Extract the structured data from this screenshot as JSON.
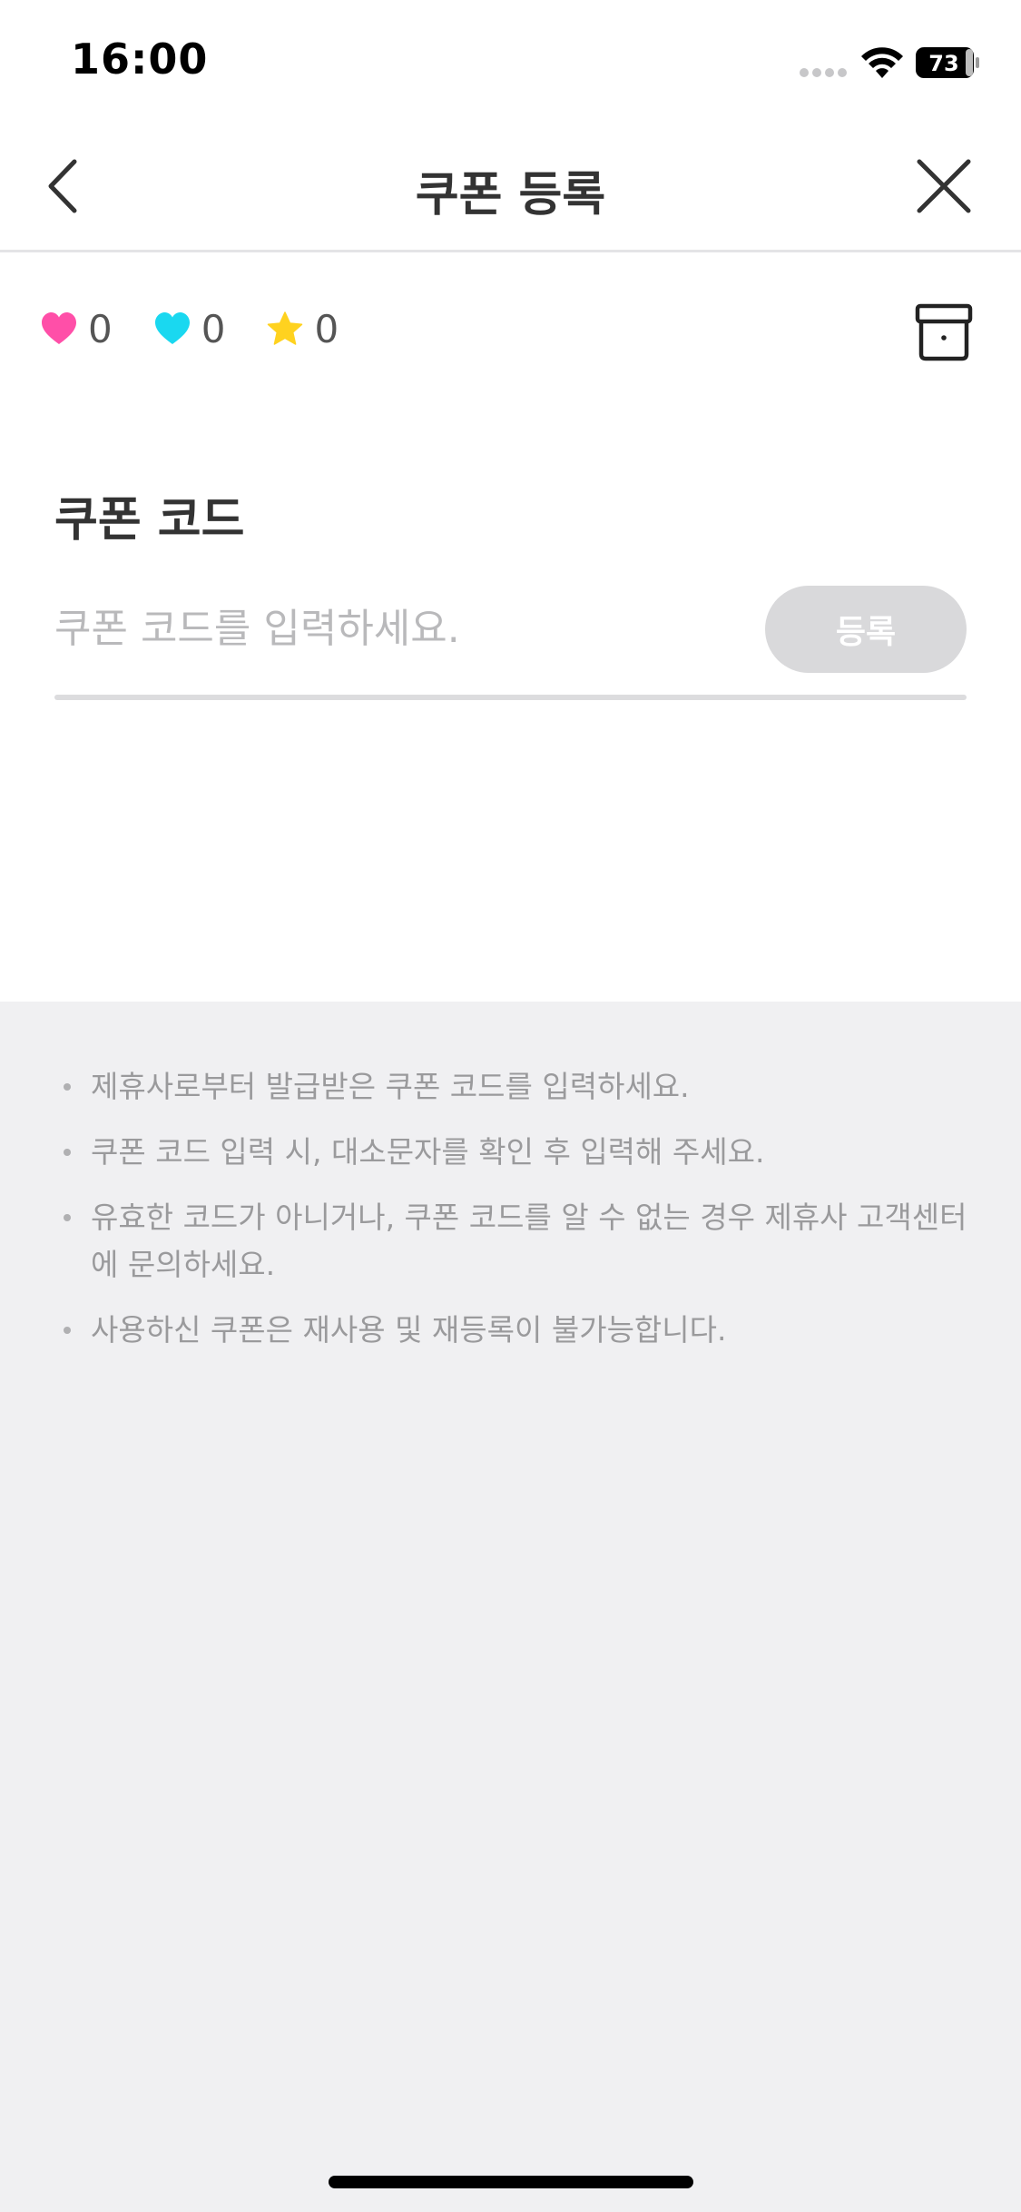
{
  "status_bar": {
    "time": "16:00",
    "battery_level": "73"
  },
  "nav": {
    "title": "쿠폰 등록",
    "back_icon": "chevron-left-icon",
    "close_icon": "close-icon"
  },
  "points": [
    {
      "icon": "pink-heart-icon",
      "color": "#ff4fa8",
      "value": "0"
    },
    {
      "icon": "cyan-heart-icon",
      "color": "#1ad8f0",
      "value": "0"
    },
    {
      "icon": "star-icon",
      "color": "#ffd21f",
      "value": "0"
    }
  ],
  "storage_icon": "box-icon",
  "coupon": {
    "section_title": "쿠폰 코드",
    "input_placeholder": "쿠폰 코드를 입력하세요.",
    "input_value": "",
    "register_label": "등록",
    "register_button_color": "#d9d9db"
  },
  "notices": [
    "제휴사로부터 발급받은 쿠폰 코드를 입력하세요.",
    "쿠폰 코드 입력 시, 대소문자를 확인 후 입력해 주세요.",
    "유효한 코드가 아니거나, 쿠폰 코드를 알 수 없는 경우 제휴사 고객센터에 문의하세요.",
    "사용하신 쿠폰은 재사용 및 재등록이 불가능합니다."
  ]
}
